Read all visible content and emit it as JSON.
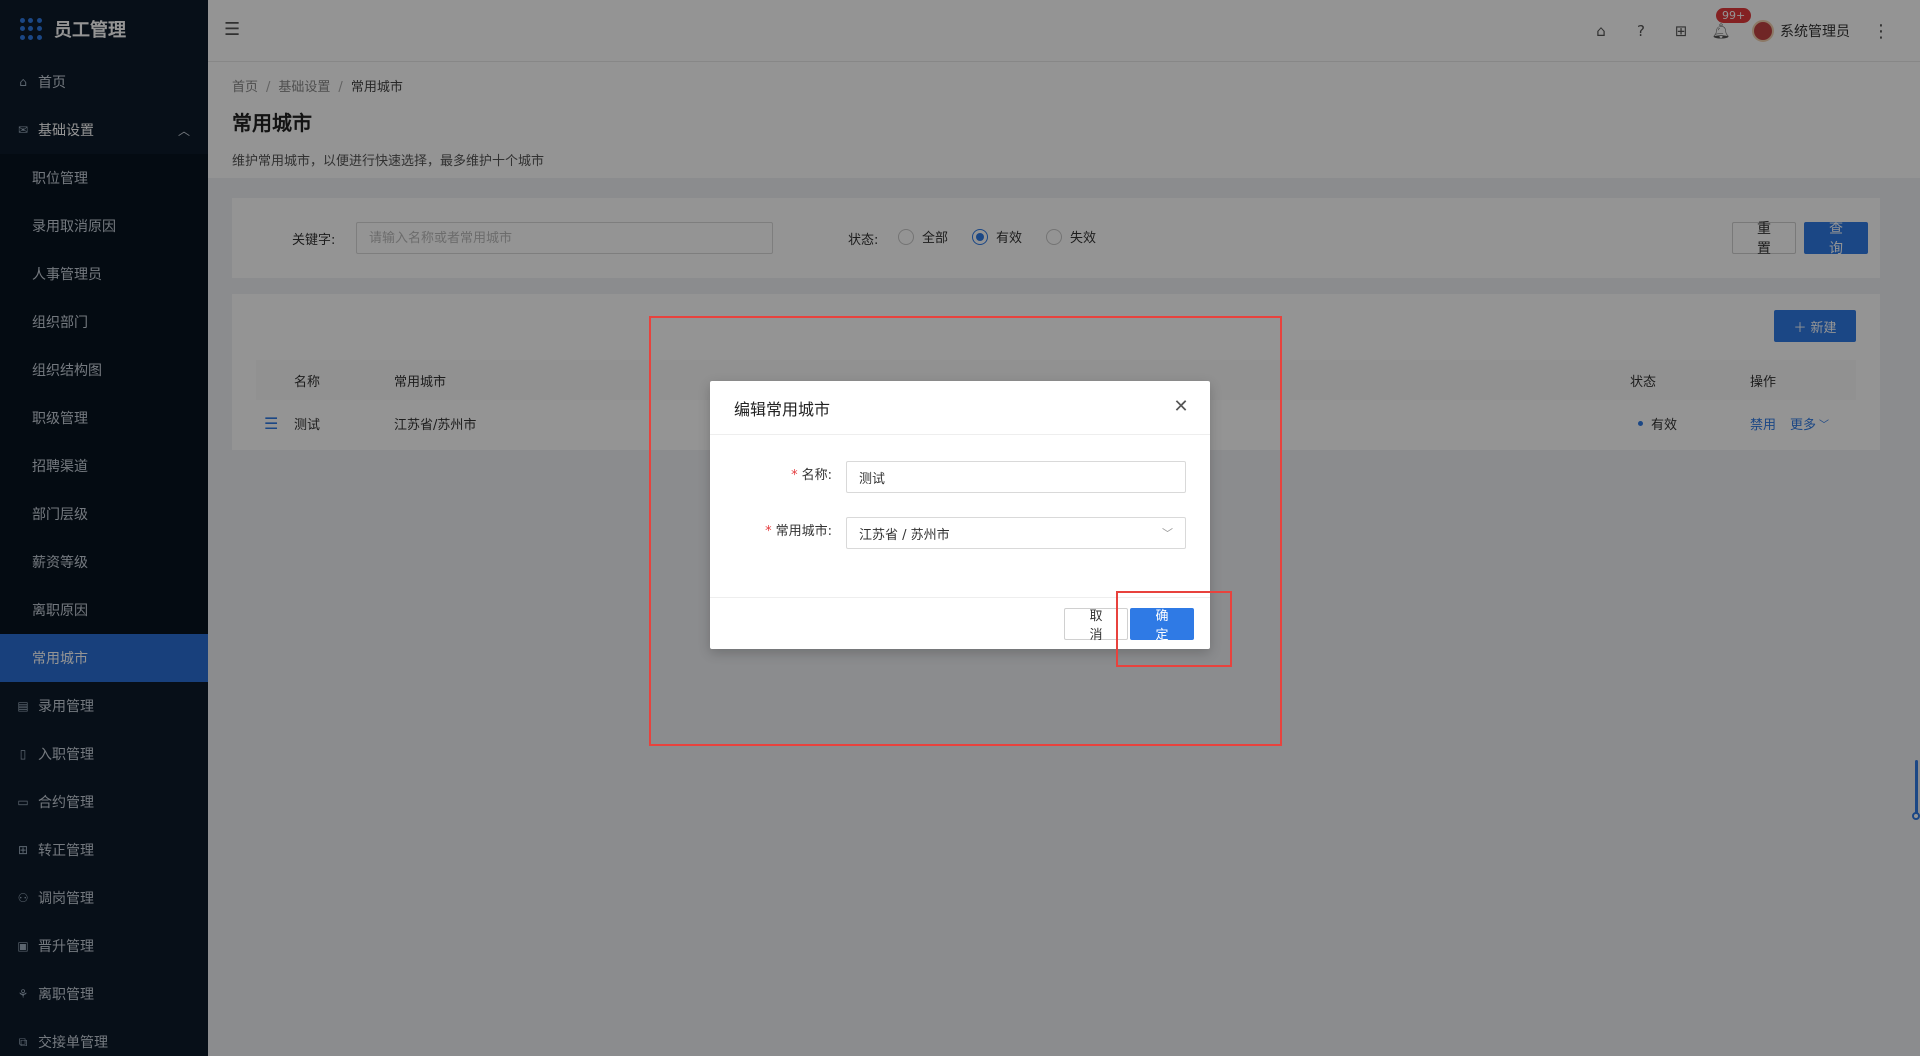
{
  "app": {
    "title": "员工管理"
  },
  "sidebar": {
    "top_items": [
      {
        "label": "首页",
        "icon": "home-icon"
      }
    ],
    "group": {
      "label": "基础设置",
      "icon": "mail-icon",
      "expanded": true
    },
    "sub_items": [
      {
        "label": "职位管理"
      },
      {
        "label": "录用取消原因"
      },
      {
        "label": "人事管理员"
      },
      {
        "label": "组织部门"
      },
      {
        "label": "组织结构图"
      },
      {
        "label": "职级管理"
      },
      {
        "label": "招聘渠道"
      },
      {
        "label": "部门层级"
      },
      {
        "label": "薪资等级"
      },
      {
        "label": "离职原因"
      },
      {
        "label": "常用城市",
        "active": true
      }
    ],
    "bottom_items": [
      {
        "label": "录用管理",
        "icon": "hire-icon"
      },
      {
        "label": "入职管理",
        "icon": "onboard-icon"
      },
      {
        "label": "合约管理",
        "icon": "contract-icon"
      },
      {
        "label": "转正管理",
        "icon": "regularize-icon"
      },
      {
        "label": "调岗管理",
        "icon": "transfer-icon"
      },
      {
        "label": "晋升管理",
        "icon": "promotion-icon"
      },
      {
        "label": "离职管理",
        "icon": "resign-icon"
      },
      {
        "label": "交接单管理",
        "icon": "handover-icon"
      }
    ]
  },
  "header": {
    "notification_count": "99+",
    "user_name": "系统管理员"
  },
  "page": {
    "breadcrumb": [
      "首页",
      "基础设置",
      "常用城市"
    ],
    "title": "常用城市",
    "description": "维护常用城市，以便进行快速选择，最多维护十个城市"
  },
  "filter": {
    "keyword_label": "关键字:",
    "keyword_placeholder": "请输入名称或者常用城市",
    "keyword_value": "",
    "status_label": "状态:",
    "status_options": [
      "全部",
      "有效",
      "失效"
    ],
    "status_selected": "有效",
    "reset_label": "重 置",
    "query_label": "查 询"
  },
  "table": {
    "new_label": "新建",
    "columns": {
      "name": "名称",
      "city": "常用城市",
      "status": "状态",
      "actions": "操作"
    },
    "rows": [
      {
        "name": "测试",
        "city": "江苏省/苏州市",
        "status": "有效",
        "action_primary": "禁用",
        "action_more": "更多"
      }
    ]
  },
  "modal": {
    "title": "编辑常用城市",
    "name_label": "名称:",
    "name_value": "测试",
    "city_label": "常用城市:",
    "city_value": "江苏省 / 苏州市",
    "cancel_label": "取 消",
    "ok_label": "确 定"
  },
  "colors": {
    "sidebar_bg": "#0d1b2a",
    "accent": "#2f7ae5",
    "annotation": "#e8423d",
    "badge": "#e4393c"
  }
}
